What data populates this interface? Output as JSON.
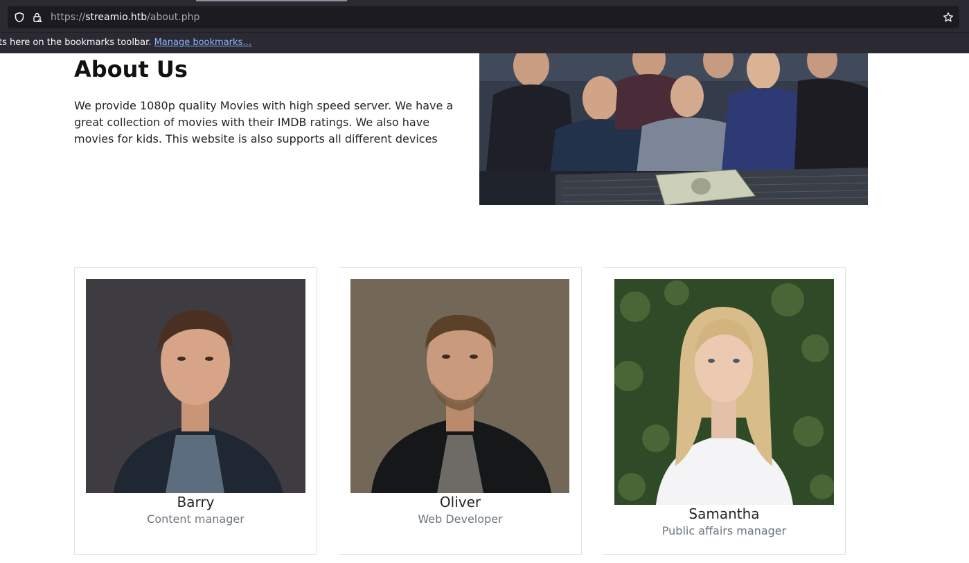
{
  "browser": {
    "url_scheme": "https://",
    "url_host": "streamio.htb",
    "url_path": "/about.php",
    "bookmarks_message": "ts here on the bookmarks toolbar.",
    "bookmarks_link": "Manage bookmarks…"
  },
  "about": {
    "title": "About Us",
    "description": "We provide 1080p quality Movies with high speed server. We have a great collection of movies with their IMDB ratings. We also have movies for kids. This website is also supports all different devices"
  },
  "team": [
    {
      "name": "Barry",
      "role": "Content manager"
    },
    {
      "name": "Oliver",
      "role": "Web Developer"
    },
    {
      "name": "Samantha",
      "role": "Public affairs manager"
    }
  ]
}
